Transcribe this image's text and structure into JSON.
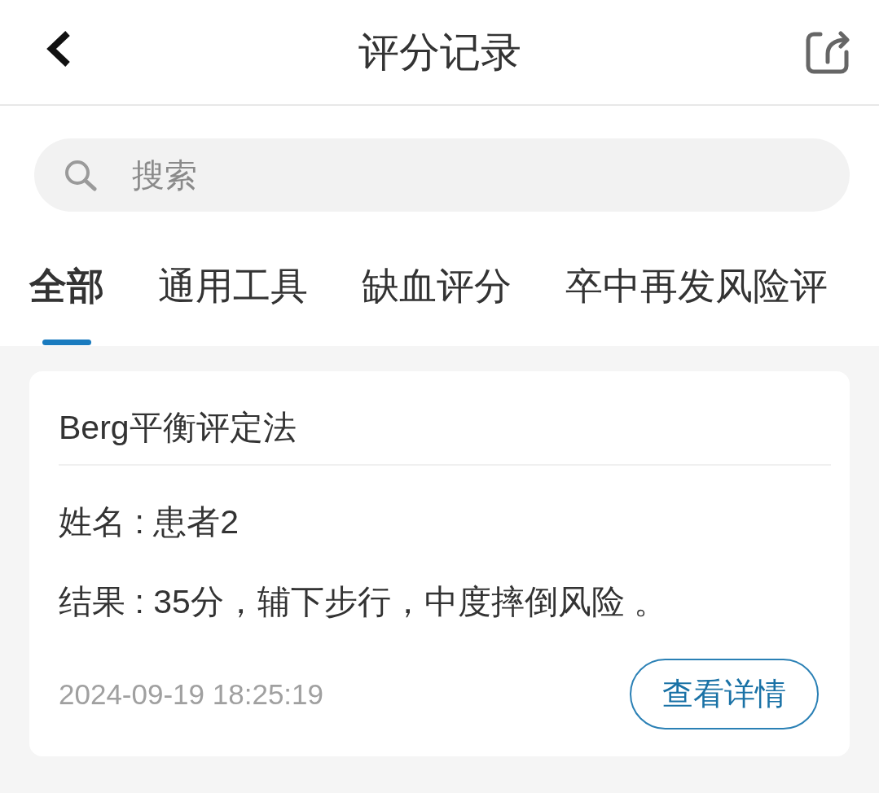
{
  "header": {
    "title": "评分记录"
  },
  "search": {
    "placeholder": "搜索"
  },
  "tabs": [
    {
      "label": "全部",
      "selected": true
    },
    {
      "label": "通用工具",
      "selected": false
    },
    {
      "label": "缺血评分",
      "selected": false
    },
    {
      "label": "卒中再发风险评",
      "selected": false
    }
  ],
  "records": [
    {
      "title": "Berg平衡评定法",
      "details": [
        "姓名 : 患者2",
        "结果 : 35分，辅下步行，中度摔倒风险 。"
      ],
      "time": "2024-09-19 18:25:19",
      "action": "查看详情"
    }
  ]
}
